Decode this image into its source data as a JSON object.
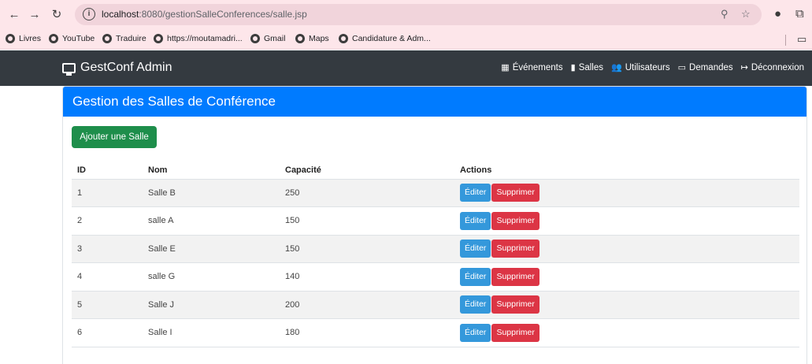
{
  "browser": {
    "url_host": "localhost",
    "url_rest": ":8080/gestionSalleConferences/salle.jsp",
    "bookmarks": [
      "Livres",
      "YouTube",
      "Traduire",
      "https://moutamadri...",
      "Gmail",
      "Maps",
      "Candidature & Adm..."
    ]
  },
  "navbar": {
    "brand": "GestConf Admin",
    "links": [
      {
        "icon": "calendar-icon",
        "label": "Événements"
      },
      {
        "icon": "door-icon",
        "label": "Salles"
      },
      {
        "icon": "users-icon",
        "label": "Utilisateurs"
      },
      {
        "icon": "inbox-icon",
        "label": "Demandes"
      },
      {
        "icon": "logout-icon",
        "label": "Déconnexion"
      }
    ]
  },
  "card": {
    "title": "Gestion des Salles de Conférence",
    "add_button": "Ajouter une Salle"
  },
  "table": {
    "headers": [
      "ID",
      "Nom",
      "Capacité",
      "Actions"
    ],
    "rows": [
      {
        "id": "1",
        "nom": "Salle B",
        "capacite": "250"
      },
      {
        "id": "2",
        "nom": "salle A",
        "capacite": "150"
      },
      {
        "id": "3",
        "nom": "Salle E",
        "capacite": "150"
      },
      {
        "id": "4",
        "nom": "salle G",
        "capacite": "140"
      },
      {
        "id": "5",
        "nom": "Salle J",
        "capacite": "200"
      },
      {
        "id": "6",
        "nom": "Salle I",
        "capacite": "180"
      }
    ],
    "edit_label": "Éditer",
    "delete_label": "Supprimer"
  },
  "colors": {
    "navbar": "#343a40",
    "header": "#007bff",
    "add_button": "#1e8e4b",
    "edit_button": "#3498db",
    "delete_button": "#dc3545"
  }
}
